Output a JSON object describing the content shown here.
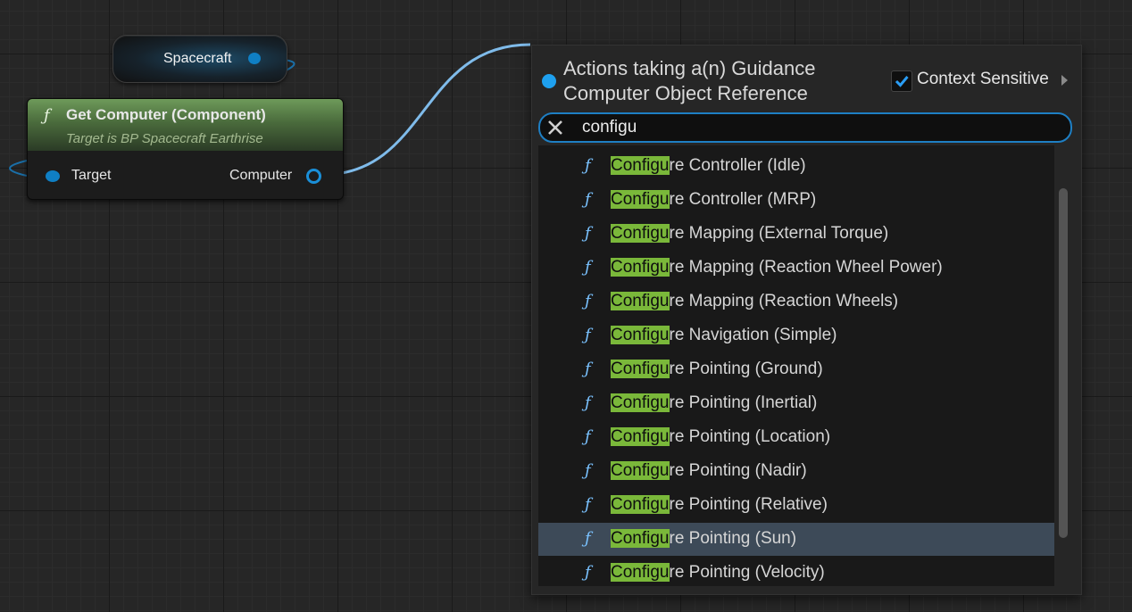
{
  "graph": {
    "variable_node": {
      "label": "Spacecraft"
    },
    "function_node": {
      "icon": "function-icon",
      "title": "Get Computer (Component)",
      "subtitle": "Target is BP Spacecraft Earthrise",
      "input_pin": "Target",
      "output_pin": "Computer"
    }
  },
  "menu": {
    "title": "Actions taking a(n) Guidance Computer Object Reference",
    "context_sensitive": {
      "label": "Context Sensitive",
      "checked": true
    },
    "search": {
      "value": "configu"
    },
    "items": [
      {
        "match": "Configu",
        "rest": "re Controller (Idle)",
        "selected": false
      },
      {
        "match": "Configu",
        "rest": "re Controller (MRP)",
        "selected": false
      },
      {
        "match": "Configu",
        "rest": "re Mapping (External Torque)",
        "selected": false
      },
      {
        "match": "Configu",
        "rest": "re Mapping (Reaction Wheel Power)",
        "selected": false
      },
      {
        "match": "Configu",
        "rest": "re Mapping (Reaction Wheels)",
        "selected": false
      },
      {
        "match": "Configu",
        "rest": "re Navigation (Simple)",
        "selected": false
      },
      {
        "match": "Configu",
        "rest": "re Pointing (Ground)",
        "selected": false
      },
      {
        "match": "Configu",
        "rest": "re Pointing (Inertial)",
        "selected": false
      },
      {
        "match": "Configu",
        "rest": "re Pointing (Location)",
        "selected": false
      },
      {
        "match": "Configu",
        "rest": "re Pointing (Nadir)",
        "selected": false
      },
      {
        "match": "Configu",
        "rest": "re Pointing (Relative)",
        "selected": false
      },
      {
        "match": "Configu",
        "rest": "re Pointing (Sun)",
        "selected": true
      },
      {
        "match": "Configu",
        "rest": "re Pointing (Velocity)",
        "selected": false
      }
    ],
    "colors": {
      "accent": "#1e7fc4",
      "match_highlight": "#7ab83a",
      "selected_row": "#3d4a58"
    }
  }
}
